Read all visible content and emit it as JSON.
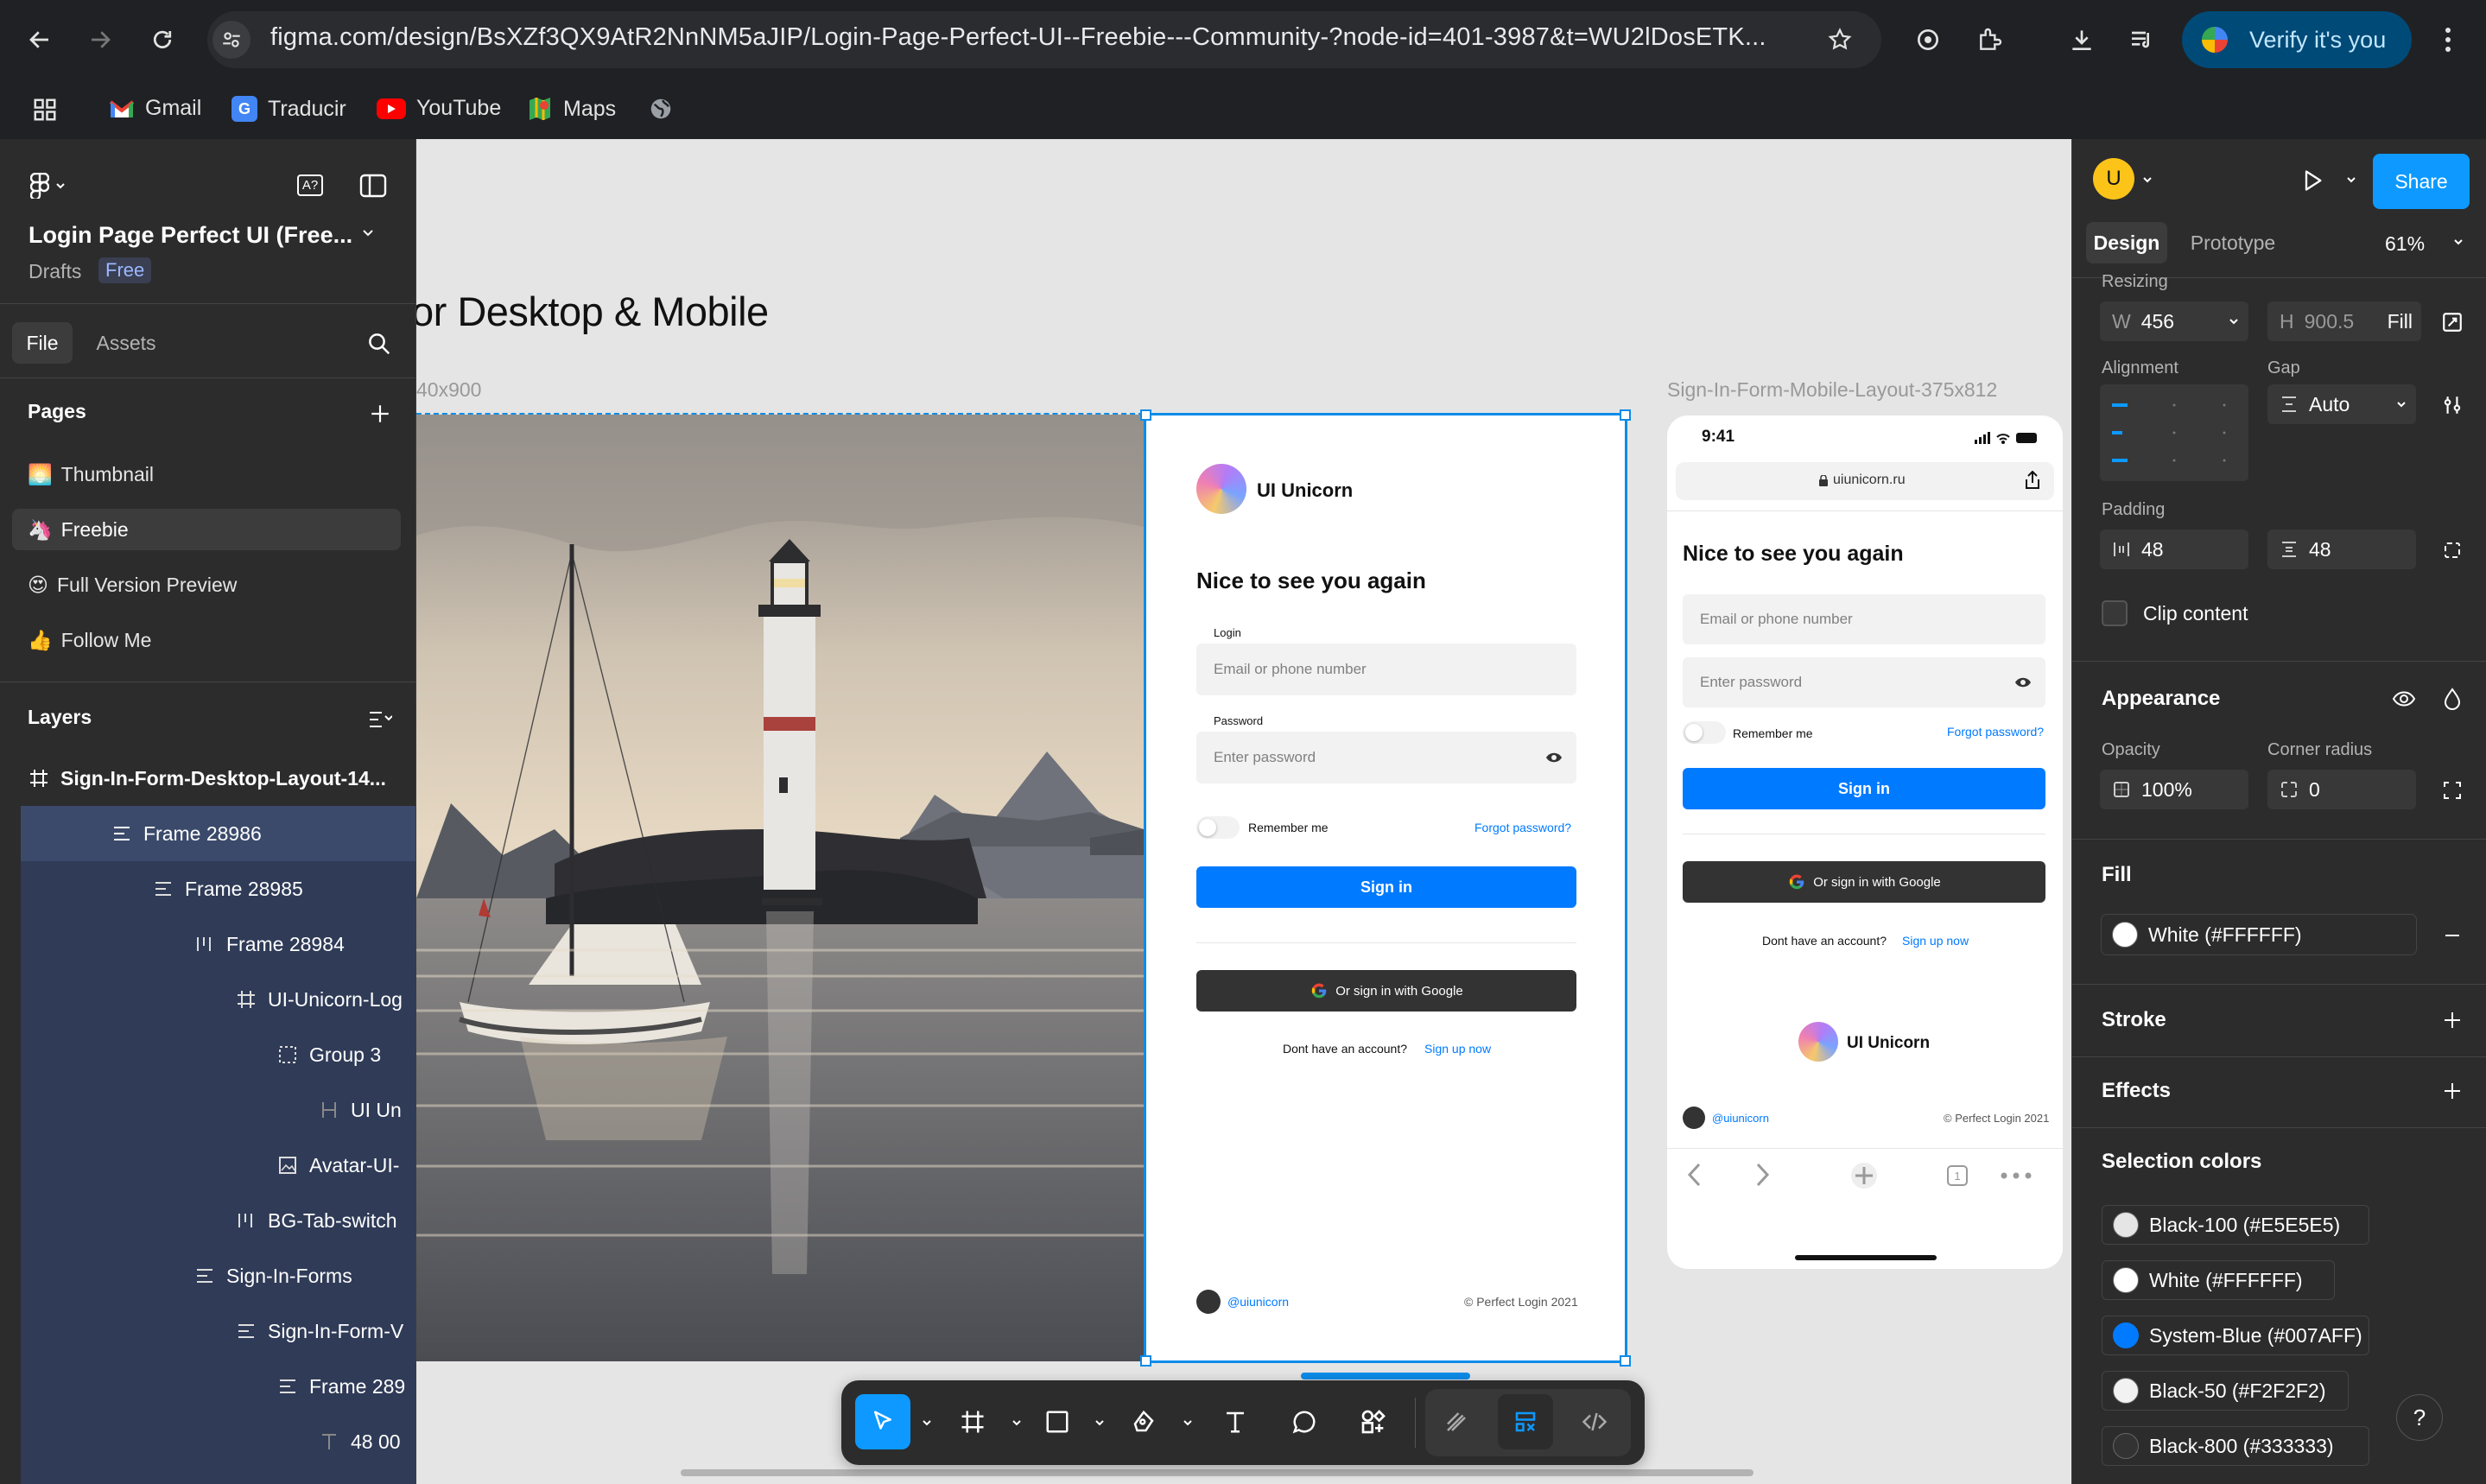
{
  "browser": {
    "url": "figma.com/design/BsXZf3QX9AtR2NnNM5aJIP/Login-Page-Perfect-UI--Freebie---Community-?node-id=401-3987&t=WU2lDosETK...",
    "verify_label": "Verify it's you",
    "bookmarks": [
      "Gmail",
      "Traducir",
      "YouTube",
      "Maps"
    ]
  },
  "figma": {
    "file_title": "Login Page Perfect UI (Free...",
    "drafts_label": "Drafts",
    "plan_badge": "Free",
    "tabs": {
      "file": "File",
      "assets": "Assets"
    },
    "pages_title": "Pages",
    "pages": [
      {
        "emoji": "🌅",
        "label": "Thumbnail"
      },
      {
        "emoji": "🦄",
        "label": "Freebie"
      },
      {
        "emoji": "😍",
        "label": "Full Version Preview"
      },
      {
        "emoji": "👍",
        "label": "Follow Me"
      }
    ],
    "layers_title": "Layers",
    "layers": [
      "Sign-In-Form-Desktop-Layout-14...",
      "Frame 28986",
      "Frame 28985",
      "Frame 28984",
      "UI-Unicorn-Log",
      "Group 3",
      "UI Un",
      "Avatar-UI-",
      "BG-Tab-switch",
      "Sign-In-Forms",
      "Sign-In-Form-V",
      "Frame 289",
      "48 00"
    ]
  },
  "canvas": {
    "heading": "or Desktop & Mobile",
    "desktop_frame_label": "40x900",
    "mobile_frame_label": "Sign-In-Form-Mobile-Layout-375x812"
  },
  "login": {
    "brand": "UI Unicorn",
    "title": "Nice to see you again",
    "login_label": "Login",
    "email_placeholder": "Email or phone number",
    "password_label": "Password",
    "password_placeholder": "Enter password",
    "remember": "Remember me",
    "forgot": "Forgot password?",
    "sign_in": "Sign in",
    "google": "Or sign in with Google",
    "no_account": "Dont have an account?",
    "sign_up": "Sign up now",
    "handle": "@uiunicorn",
    "copyright": "© Perfect Login 2021"
  },
  "mobile": {
    "time": "9:41",
    "address": "uiunicorn.ru"
  },
  "design_panel": {
    "avatar_letter": "U",
    "share": "Share",
    "tabs": {
      "design": "Design",
      "prototype": "Prototype"
    },
    "zoom": "61%",
    "resizing": "Resizing",
    "w_label": "W",
    "w_value": "456",
    "h_label": "H",
    "h_value": "900.5",
    "h_mode": "Fill",
    "alignment": "Alignment",
    "gap": "Gap",
    "gap_value": "Auto",
    "padding": "Padding",
    "padding_h": "48",
    "padding_v": "48",
    "clip_content": "Clip content",
    "appearance": "Appearance",
    "opacity_label": "Opacity",
    "opacity_value": "100%",
    "radius_label": "Corner radius",
    "radius_value": "0",
    "fill": "Fill",
    "fill_value": "White (#FFFFFF)",
    "stroke": "Stroke",
    "effects": "Effects",
    "selection_colors": "Selection colors",
    "colors": [
      {
        "label": "Black-100 (#E5E5E5)",
        "hex": "#E5E5E5"
      },
      {
        "label": "White (#FFFFFF)",
        "hex": "#FFFFFF"
      },
      {
        "label": "System-Blue (#007AFF)",
        "hex": "#007AFF"
      },
      {
        "label": "Black-50 (#F2F2F2)",
        "hex": "#F2F2F2"
      },
      {
        "label": "Black-800 (#333333)",
        "hex": "#333333"
      }
    ],
    "help": "?"
  },
  "colors": {
    "accent": "#007AFF",
    "figma_blue": "#0d99ff",
    "selection": "#0c8ce9"
  }
}
